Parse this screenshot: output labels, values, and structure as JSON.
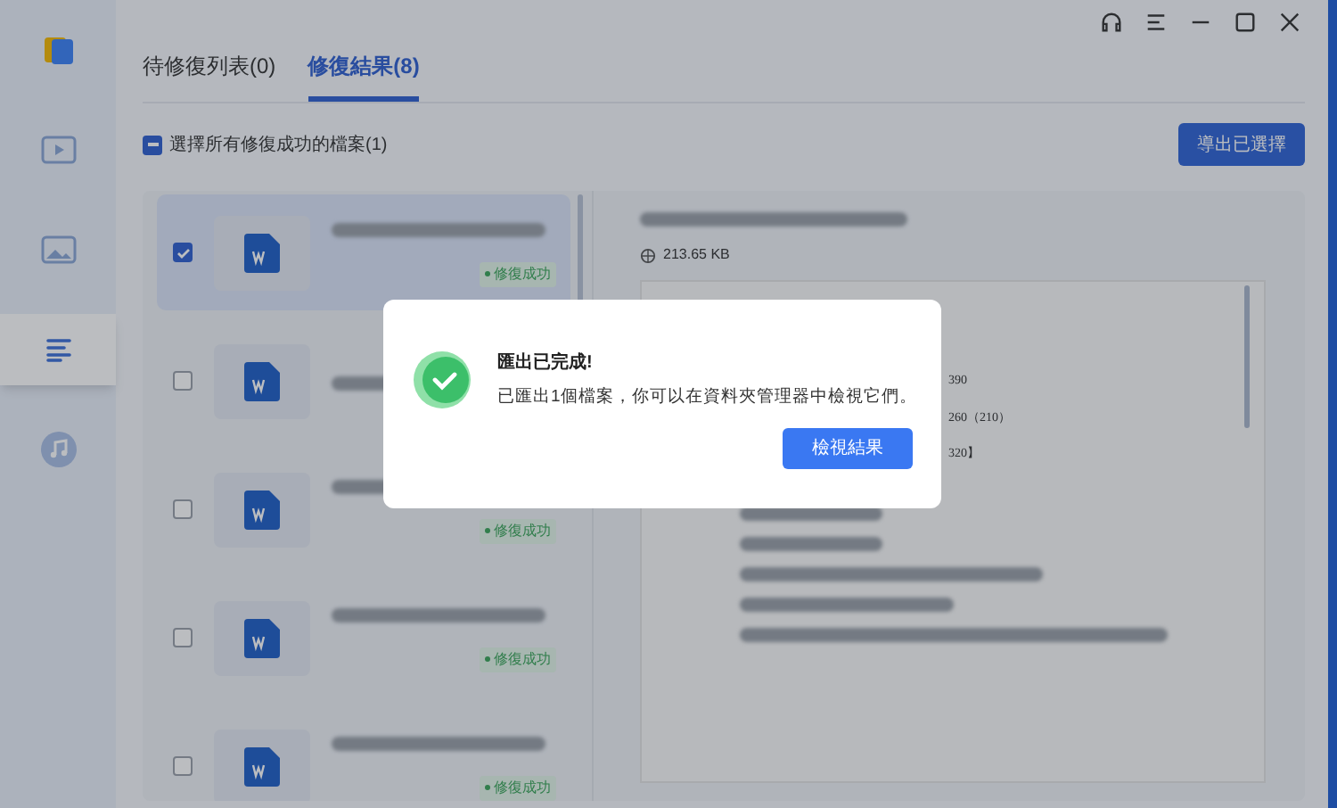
{
  "sidebar": {
    "items": [
      {
        "kind": "logo",
        "selected": false
      },
      {
        "kind": "video",
        "selected": false
      },
      {
        "kind": "image",
        "selected": false
      },
      {
        "kind": "document",
        "selected": true
      },
      {
        "kind": "music",
        "selected": false
      }
    ]
  },
  "tabs": [
    {
      "label": "待修復列表(0)",
      "selected": false
    },
    {
      "label": "修復結果(8)",
      "selected": true
    }
  ],
  "select_all": {
    "label": "選擇所有修復成功的檔案(1)",
    "indeterminate": true
  },
  "export_button": "導出已選擇",
  "files": [
    {
      "checked": true,
      "status": "修復成功"
    },
    {
      "checked": false
    },
    {
      "checked": false,
      "status": "修復成功"
    },
    {
      "checked": false,
      "status": "修復成功"
    },
    {
      "checked": false,
      "status": "修復成功"
    }
  ],
  "preview": {
    "size": "213.65 KB",
    "document_fragments": [
      "390",
      "260（210）",
      "320】"
    ]
  },
  "dialog": {
    "title": "匯出已完成!",
    "message": "已匯出1個檔案，你可以在資料夾管理器中檢視它們。",
    "button": "檢視結果"
  }
}
